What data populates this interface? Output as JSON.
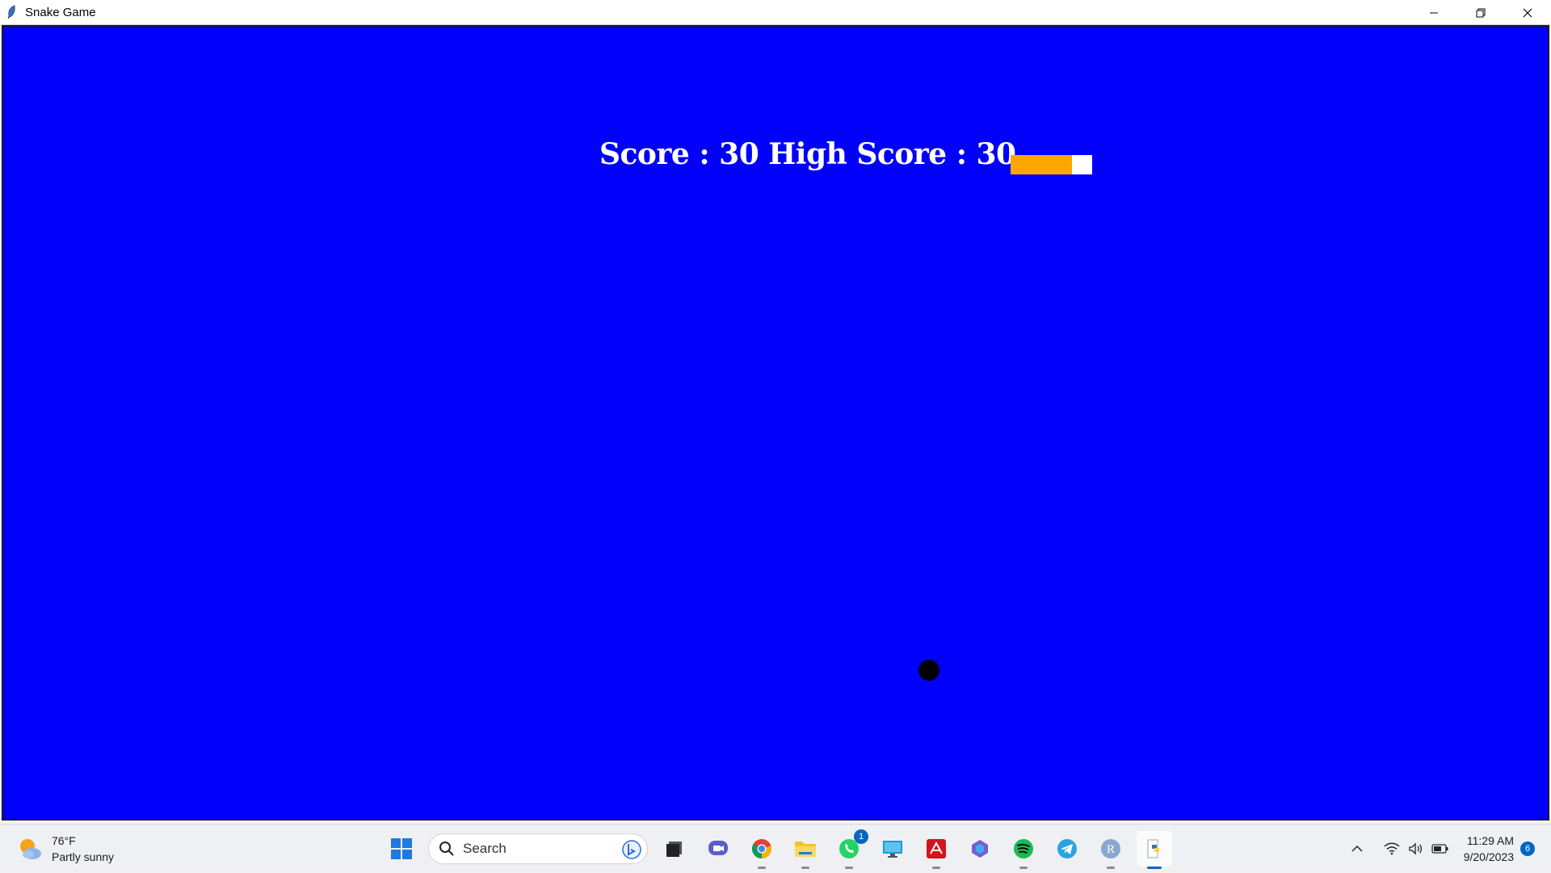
{
  "window": {
    "title": "Snake Game",
    "app_icon": "feather-icon"
  },
  "game": {
    "background_color": "#0000fb",
    "score_text": "Score : 30 High Score : 30",
    "snake": {
      "head_color": "#ffffff",
      "body_color": "#ffa500"
    },
    "food_color": "#000000"
  },
  "taskbar": {
    "weather": {
      "temperature": "76°F",
      "condition": "Partly sunny"
    },
    "search_placeholder": "Search",
    "apps": [
      {
        "name": "task-view-icon"
      },
      {
        "name": "chat-icon"
      },
      {
        "name": "chrome-icon"
      },
      {
        "name": "file-explorer-icon"
      },
      {
        "name": "whatsapp-icon",
        "badge": "1"
      },
      {
        "name": "remote-desktop-icon"
      },
      {
        "name": "acrobat-icon"
      },
      {
        "name": "copilot-icon"
      },
      {
        "name": "spotify-icon"
      },
      {
        "name": "telegram-icon"
      },
      {
        "name": "r-icon"
      },
      {
        "name": "python-icon"
      }
    ],
    "clock": {
      "time": "11:29 AM",
      "date": "9/20/2023"
    },
    "notification_count": "6"
  }
}
